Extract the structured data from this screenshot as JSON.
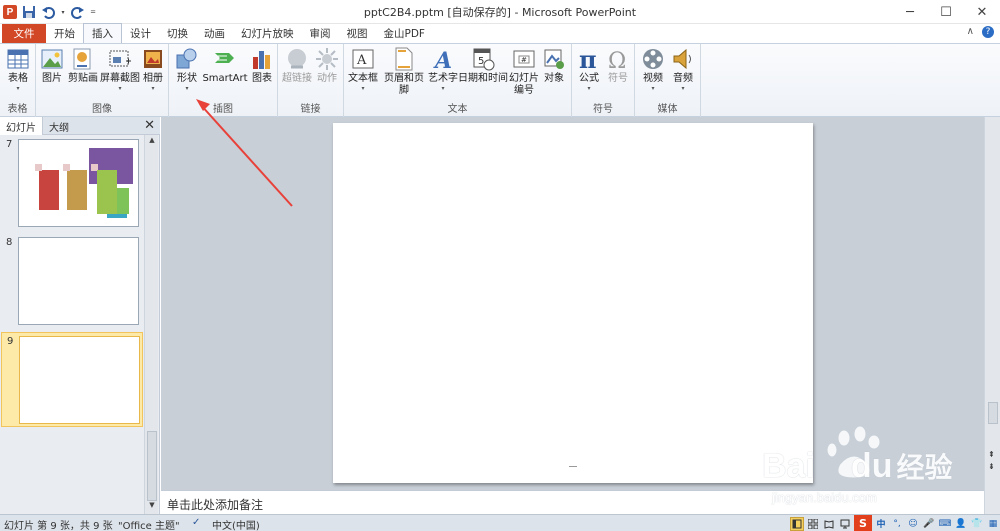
{
  "window": {
    "title": "pptC2B4.pptm [自动保存的] - Microsoft PowerPoint",
    "minimize": "─",
    "maximize": "☐",
    "close": "✕"
  },
  "qat": {
    "app_icon": "P",
    "save_icon": "save-icon",
    "undo_icon": "undo-icon",
    "redo_icon": "redo-icon",
    "customize_icon": "customize-icon"
  },
  "tabs": [
    {
      "label": "文件"
    },
    {
      "label": "开始"
    },
    {
      "label": "插入"
    },
    {
      "label": "设计"
    },
    {
      "label": "切换"
    },
    {
      "label": "动画"
    },
    {
      "label": "幻灯片放映"
    },
    {
      "label": "审阅"
    },
    {
      "label": "视图"
    },
    {
      "label": "金山PDF"
    }
  ],
  "tabs_right": {
    "collapse": "∧",
    "help": "?"
  },
  "ribbon": {
    "groups": [
      {
        "label": "表格"
      },
      {
        "label": "图像"
      },
      {
        "label": "插图"
      },
      {
        "label": "链接"
      },
      {
        "label": "文本"
      },
      {
        "label": "符号"
      },
      {
        "label": "媒体"
      }
    ],
    "buttons": {
      "table": "表格",
      "picture": "图片",
      "clipart": "剪贴画",
      "screenshot": "屏幕截图",
      "album": "相册",
      "shapes": "形状",
      "smartart": "SmartArt",
      "chart": "图表",
      "hyperlink": "超链接",
      "action": "动作",
      "textbox": "文本框",
      "header_footer": "页眉和页脚",
      "wordart": "艺术字",
      "datetime": "日期和时间",
      "slide_number_l1": "幻灯片",
      "slide_number_l2": "编号",
      "object": "对象",
      "equation": "公式",
      "symbol": "符号",
      "video": "视频",
      "audio": "音频"
    }
  },
  "leftpane": {
    "tab_slides": "幻灯片",
    "tab_outline": "大纲",
    "close": "✕",
    "slides": [
      {
        "num": "7"
      },
      {
        "num": "8"
      },
      {
        "num": "9"
      }
    ]
  },
  "notes": {
    "placeholder": "单击此处添加备注"
  },
  "status": {
    "slide_info": "幻灯片 第 9 张，共 9 张",
    "theme": "\"Office 主题\"",
    "language": "中文(中国)"
  },
  "ime": {
    "cn": "中"
  },
  "watermark": {
    "brand": "Bai",
    "brand2": "du",
    "cn": "经验",
    "url": "jingyan.baidu.com"
  },
  "colors": {
    "file_tab": "#d24726",
    "accent": "#2b579a",
    "annotation_arrow": "#e8413a",
    "selected_slide": "#fde9a8"
  }
}
